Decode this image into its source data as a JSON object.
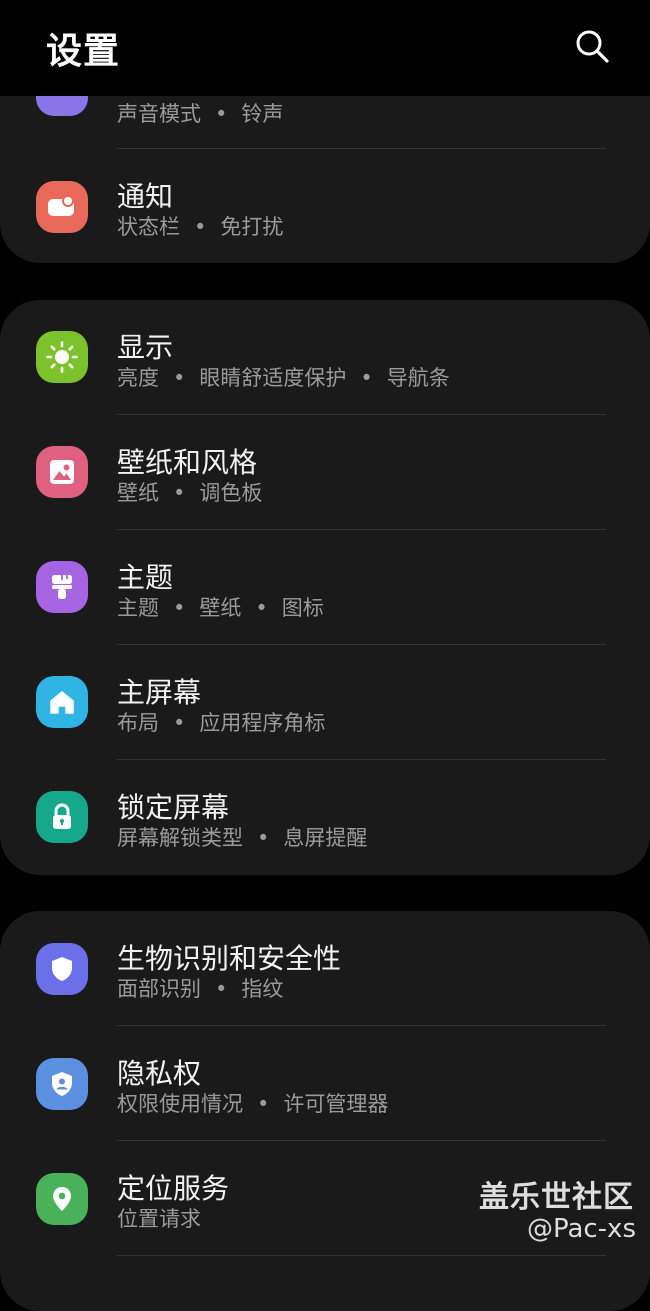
{
  "header": {
    "title": "设置"
  },
  "card1": {
    "partial_item": {
      "sub": [
        "声音模式",
        "铃声"
      ],
      "icon_color": "#8a75e6"
    },
    "items": [
      {
        "label": "通知",
        "sub": [
          "状态栏",
          "免打扰"
        ],
        "icon": "notification-icon",
        "icon_color": "#e8695a"
      }
    ]
  },
  "card2": {
    "items": [
      {
        "label": "显示",
        "sub": [
          "亮度",
          "眼睛舒适度保护",
          "导航条"
        ],
        "icon": "sun-icon",
        "icon_color": "#7cc22c"
      },
      {
        "label": "壁纸和风格",
        "sub": [
          "壁纸",
          "调色板"
        ],
        "icon": "image-icon",
        "icon_color": "#e0607f"
      },
      {
        "label": "主题",
        "sub": [
          "主题",
          "壁纸",
          "图标"
        ],
        "icon": "paintbrush-icon",
        "icon_color": "#a565e2"
      },
      {
        "label": "主屏幕",
        "sub": [
          "布局",
          "应用程序角标"
        ],
        "icon": "home-icon",
        "icon_color": "#2fb4e4"
      },
      {
        "label": "锁定屏幕",
        "sub": [
          "屏幕解锁类型",
          "息屏提醒"
        ],
        "icon": "lock-icon",
        "icon_color": "#16a88a"
      }
    ]
  },
  "card3": {
    "items": [
      {
        "label": "生物识别和安全性",
        "sub": [
          "面部识别",
          "指纹"
        ],
        "icon": "shield-icon",
        "icon_color": "#6b6fe8"
      },
      {
        "label": "隐私权",
        "sub": [
          "权限使用情况",
          "许可管理器"
        ],
        "icon": "privacy-shield-icon",
        "icon_color": "#5b8fe0"
      },
      {
        "label": "定位服务",
        "sub": [
          "位置请求"
        ],
        "icon": "location-pin-icon",
        "icon_color": "#49b15a"
      }
    ]
  },
  "watermark": {
    "line1": "盖乐世社区",
    "line2": "@Pac-xs"
  }
}
